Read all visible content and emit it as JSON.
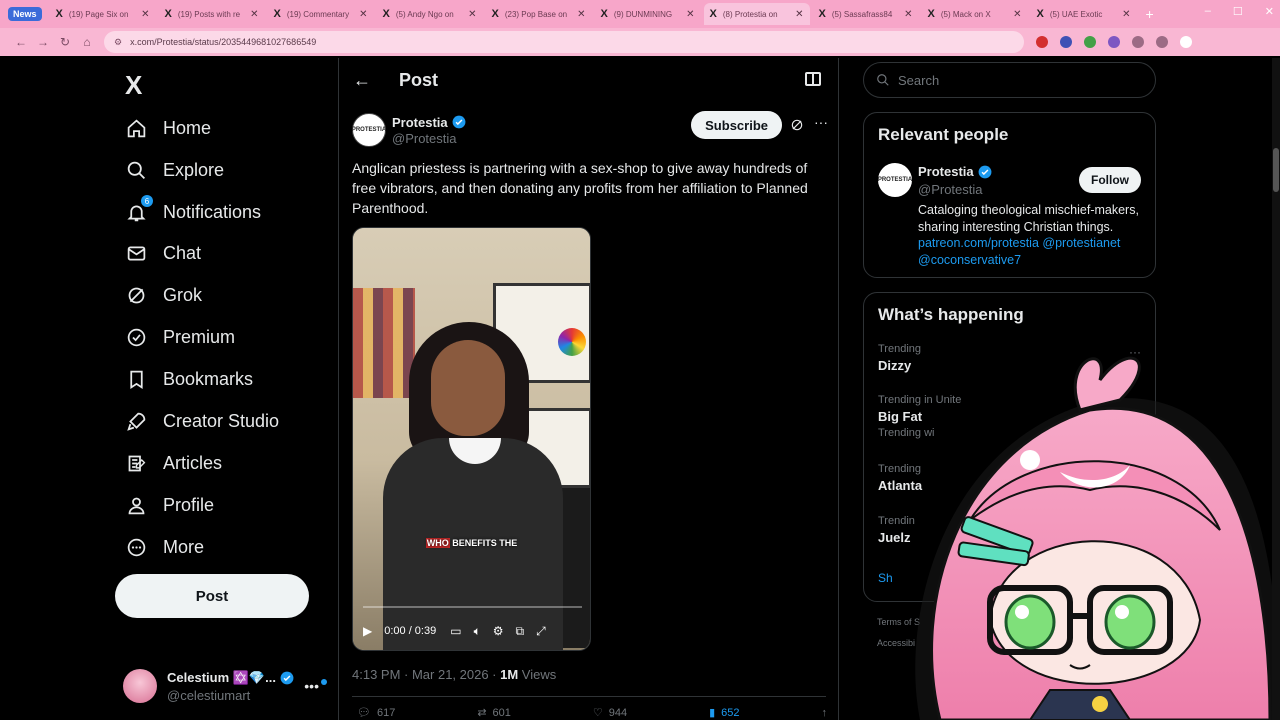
{
  "browser": {
    "news_badge": "News",
    "tabs": [
      {
        "title": "(19) Page Six on",
        "active": false
      },
      {
        "title": "(19) Posts with re",
        "active": false
      },
      {
        "title": "(19) Commentary",
        "active": false
      },
      {
        "title": "(5) Andy Ngo on",
        "active": false
      },
      {
        "title": "(23) Pop Base on",
        "active": false
      },
      {
        "title": "(9) DUNMINING",
        "active": false
      },
      {
        "title": "(8) Protestia on",
        "active": true
      },
      {
        "title": "(5) Sassafrass84",
        "active": false
      },
      {
        "title": "(5) Mack on X",
        "active": false
      },
      {
        "title": "(5) UAE Exotic",
        "active": false
      }
    ],
    "url": "x.com/Protestia/status/2035449681027686549"
  },
  "sidebar": {
    "brand": "X",
    "items": [
      {
        "label": "Home",
        "icon": "home-icon",
        "bold": false
      },
      {
        "label": "Explore",
        "icon": "search-icon",
        "bold": false
      },
      {
        "label": "Notifications",
        "icon": "bell-icon",
        "bold": false,
        "badge": "6"
      },
      {
        "label": "Chat",
        "icon": "mail-icon",
        "bold": false
      },
      {
        "label": "Grok",
        "icon": "grok-icon",
        "bold": false
      },
      {
        "label": "Premium",
        "icon": "premium-icon",
        "bold": false
      },
      {
        "label": "Bookmarks",
        "icon": "bookmark-icon",
        "bold": false
      },
      {
        "label": "Creator Studio",
        "icon": "rocket-icon",
        "bold": false
      },
      {
        "label": "Articles",
        "icon": "articles-icon",
        "bold": false
      },
      {
        "label": "Profile",
        "icon": "person-icon",
        "bold": false
      },
      {
        "label": "More",
        "icon": "more-circle-icon",
        "bold": false
      }
    ],
    "post_button": "Post",
    "account": {
      "name": "Celestium ✡️💎...",
      "handle": "@celestiumart"
    }
  },
  "main": {
    "title": "Post",
    "author": {
      "name": "Protestia",
      "handle": "@Protestia",
      "avatar_text": "PROTESTIA"
    },
    "subscribe": "Subscribe",
    "text": "Anglican priestess is partnering with a sex-shop to give away hundreds of free vibrators, and then donating any profits from her affiliation to Planned Parenthood.",
    "video": {
      "caption_highlight": "WHO",
      "caption_rest": " BENEFITS THE",
      "time": "0:00 / 0:39"
    },
    "meta": {
      "time": "4:13 PM · Mar 21, 2026 · ",
      "views_count": "1M",
      "views_label": " Views"
    },
    "actions": {
      "replies": "617",
      "reposts": "601",
      "likes": "944",
      "bookmarks": "652"
    }
  },
  "right": {
    "search_placeholder": "Search",
    "relevant": {
      "title": "Relevant people",
      "name": "Protestia",
      "handle": "@Protestia",
      "follow": "Follow",
      "bio_text": "Cataloging theological mischief-makers, sharing interesting Christian things. ",
      "bio_link1": "patreon.com/protestia",
      "bio_link2": "@protestianet",
      "bio_link3": "@coconservative7"
    },
    "happening": {
      "title": "What’s happening",
      "trends": [
        {
          "meta": "Trending",
          "name": "Dizzy",
          "sub": ""
        },
        {
          "meta": "Trending in Unite",
          "name": "Big Fat",
          "sub": "Trending wi"
        },
        {
          "meta": "Trending",
          "name": "Atlanta",
          "sub": ""
        },
        {
          "meta": "Trendin",
          "name": "Juelz",
          "sub": ""
        }
      ],
      "show_more": "Sh"
    },
    "footer": [
      "Terms of S",
      "Accessibi"
    ]
  },
  "colors": {
    "accent": "#1d9bf0",
    "tabbar": "#f7a6c9",
    "background": "#000000"
  }
}
